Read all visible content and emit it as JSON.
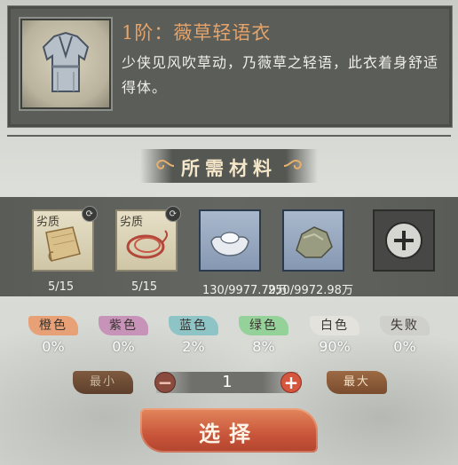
{
  "item": {
    "title": "1阶：薇草轻语衣",
    "description": "少侠见风吹草动，乃薇草之轻语，此衣着身舒适得体。",
    "icon": "robe-icon"
  },
  "section": {
    "title": "所需材料"
  },
  "materials": [
    {
      "quality_label": "劣质",
      "count": "5/15",
      "icon": "paper-scroll-icon"
    },
    {
      "quality_label": "劣质",
      "count": "5/15",
      "icon": "red-thread-icon"
    },
    {
      "quality_label": "",
      "count": "130/9977.79万",
      "icon": "silver-ingot-icon"
    },
    {
      "quality_label": "",
      "count": "250/9972.98万",
      "icon": "ore-stone-icon"
    },
    {
      "quality_label": "",
      "count": "",
      "icon": "add-material-icon"
    }
  ],
  "qualities": [
    {
      "name": "橙色",
      "percent": "0%",
      "color": "#e8a176"
    },
    {
      "name": "紫色",
      "percent": "0%",
      "color": "#c793b9"
    },
    {
      "name": "蓝色",
      "percent": "2%",
      "color": "#8fc4c6"
    },
    {
      "name": "绿色",
      "percent": "8%",
      "color": "#95d29a"
    },
    {
      "name": "白色",
      "percent": "90%",
      "color": "#e3e2dd"
    },
    {
      "name": "失败",
      "percent": "0%",
      "color": "#cfcfcb"
    }
  ],
  "quantity": {
    "min_label": "最小",
    "max_label": "最大",
    "value": "1"
  },
  "select_label": "选择"
}
